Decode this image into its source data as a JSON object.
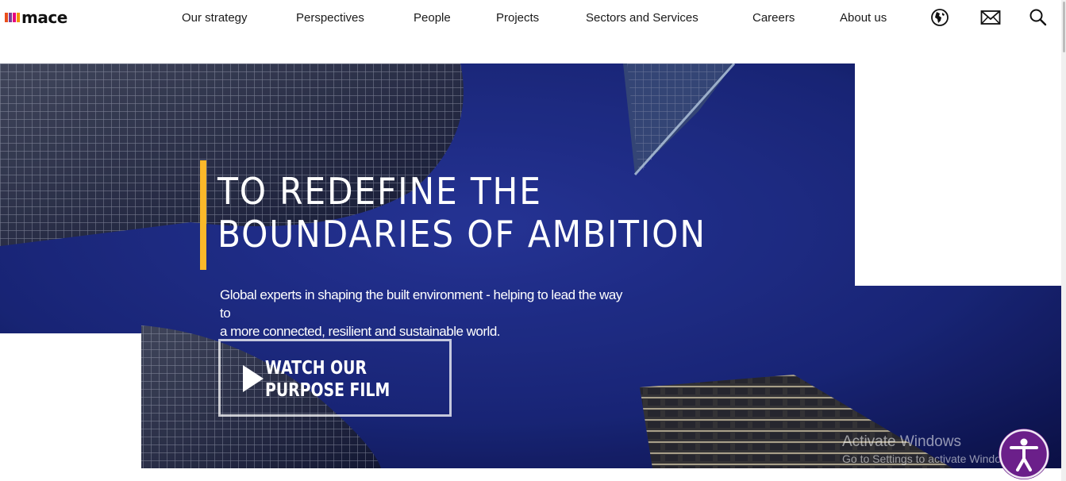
{
  "brand": {
    "name": "mace",
    "bar_colors": [
      "#e94e1b",
      "#7b3f98",
      "#e6007e",
      "#f39200",
      "#0091d3"
    ]
  },
  "nav": {
    "items": [
      {
        "label": "Our strategy"
      },
      {
        "label": "Perspectives"
      },
      {
        "label": "People"
      },
      {
        "label": "Projects"
      },
      {
        "label": "Sectors and Services"
      },
      {
        "label": "Careers"
      },
      {
        "label": "About us"
      }
    ],
    "icons": [
      "globe-icon",
      "mail-icon",
      "search-icon"
    ]
  },
  "hero": {
    "headline_line1": "TO REDEFINE THE",
    "headline_line2": "BOUNDARIES OF AMBITION",
    "subtext_line1": "Global experts in shaping the built environment - helping to lead the way to",
    "subtext_line2": "a more connected, resilient and sustainable world.",
    "film_button_line1": "WATCH OUR",
    "film_button_line2": "PURPOSE FILM"
  },
  "overlay": {
    "activate_title": "Activate Windows",
    "activate_sub": "Go to Settings to activate Windows."
  },
  "colors": {
    "accent_yellow": "#fbb829",
    "hero_blue": "#1f2c8f",
    "hero_dark": "#0e1240",
    "accessibility_purple": "#6b1f8a"
  }
}
